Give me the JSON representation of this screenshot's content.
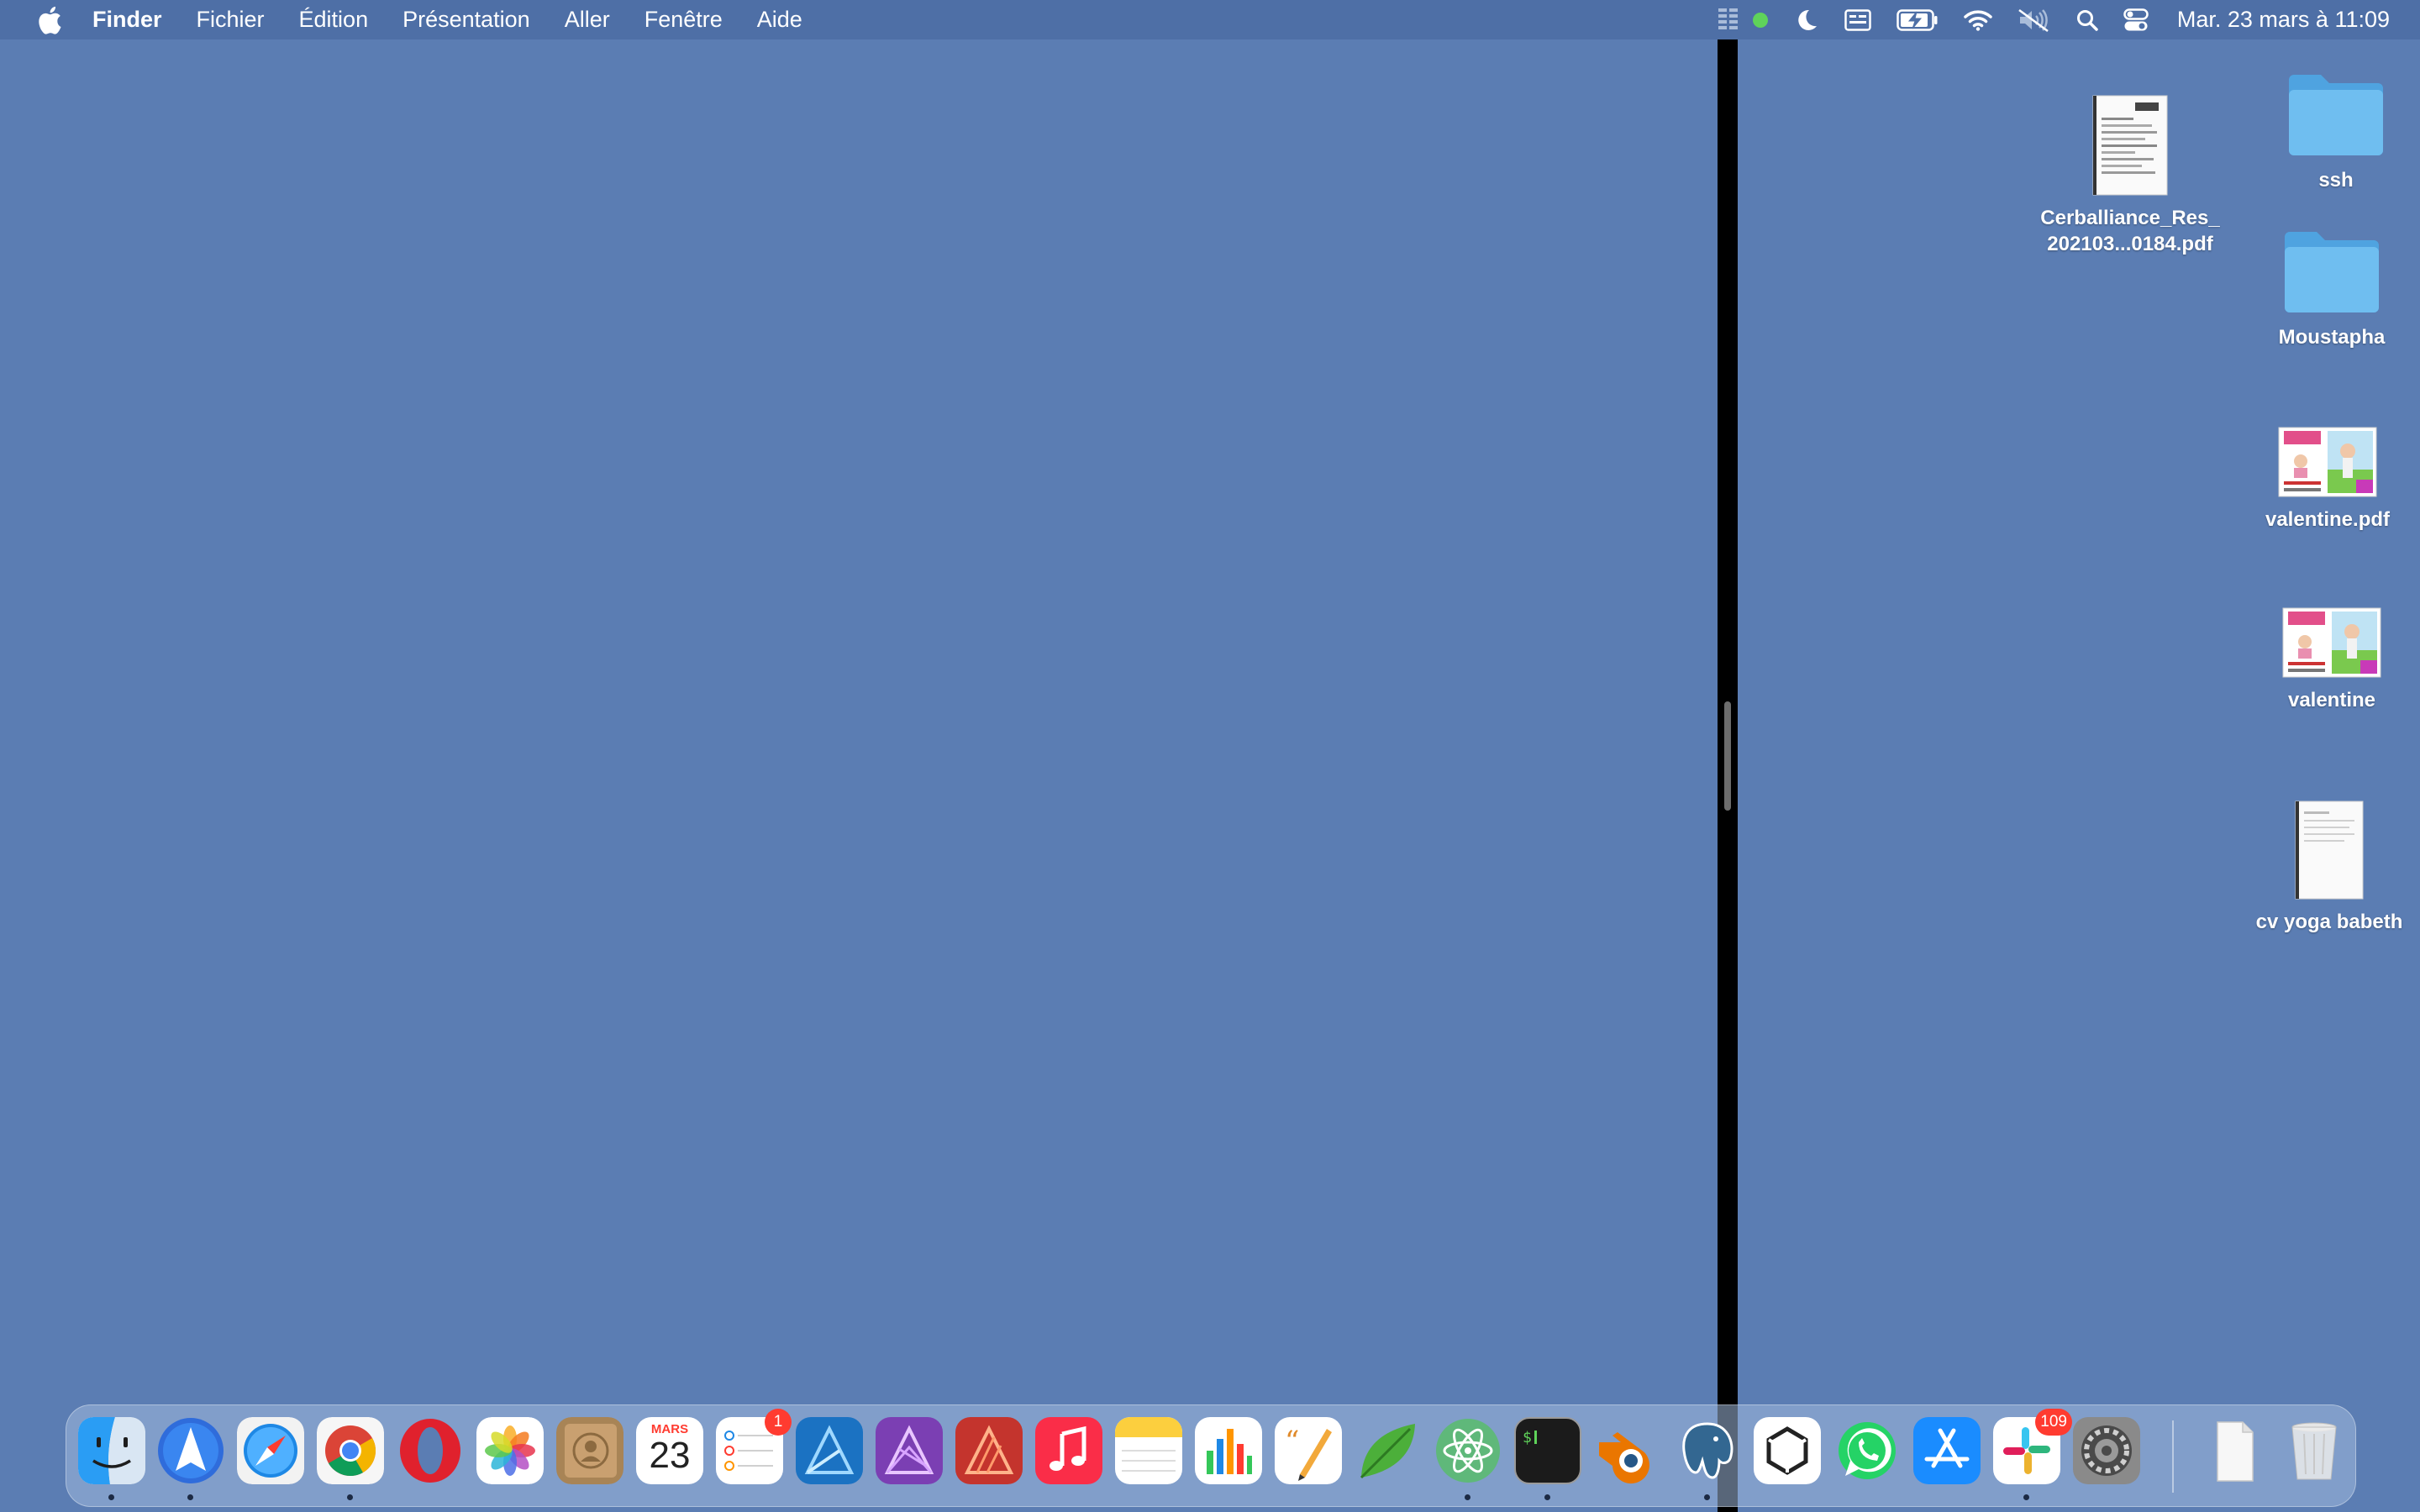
{
  "menubar": {
    "app_name": "Finder",
    "menus": [
      "Fichier",
      "Édition",
      "Présentation",
      "Aller",
      "Fenêtre",
      "Aide"
    ],
    "clock": "Mar. 23 mars à  11:09",
    "status_icons": [
      "dictation-icon",
      "green-dot-icon",
      "moon-icon",
      "keyboard-input-icon",
      "battery-charging-icon",
      "wifi-icon",
      "sound-muted-icon",
      "search-icon",
      "control-center-icon"
    ]
  },
  "desktop": {
    "items": [
      {
        "name": "ssh",
        "kind": "folder"
      },
      {
        "name_line1": "Cerballiance_Res_",
        "name_line2": "202103...0184.pdf",
        "kind": "pdf"
      },
      {
        "name": "Moustapha",
        "kind": "folder"
      },
      {
        "name": "valentine.pdf",
        "kind": "image-pdf"
      },
      {
        "name": "valentine",
        "kind": "image"
      },
      {
        "name": "cv yoga babeth",
        "kind": "document"
      }
    ]
  },
  "dock": {
    "calendar_month": "MARS",
    "calendar_day": "23",
    "reminders_badge": "1",
    "slack_badge": "109",
    "apps": [
      "Finder",
      "Spark",
      "Safari",
      "Chrome",
      "Opera",
      "Photos",
      "Contacts",
      "Calendar",
      "Reminders",
      "Affinity Designer",
      "Affinity Photo",
      "Affinity Publisher",
      "Music",
      "Notes",
      "Numbers",
      "Pages",
      "Leaf",
      "Atom",
      "Terminal",
      "Blender",
      "PostgreSQL",
      "Unity",
      "WhatsApp",
      "App Store",
      "Slack",
      "System Preferences",
      "Documents",
      "Trash"
    ],
    "colors": {
      "finder": "#2a9df4",
      "safari": "#1e88e5",
      "opera": "#e0212d",
      "music": "#fa2d48",
      "whatsapp": "#25d366",
      "appstore": "#1a8cff",
      "terminal": "#1b1b1b"
    }
  }
}
